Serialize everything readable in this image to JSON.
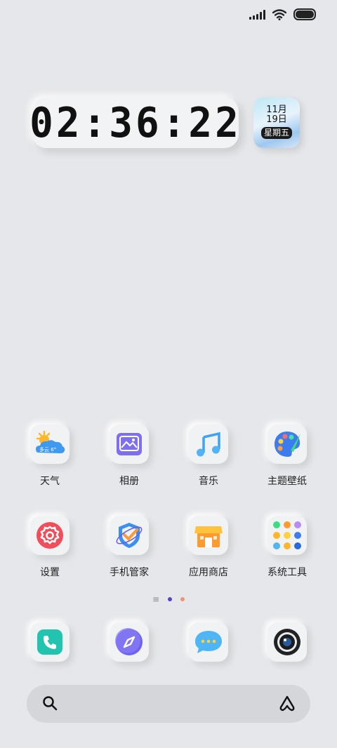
{
  "status_bar": {
    "icons": [
      "signal-icon",
      "wifi-icon",
      "battery-icon"
    ]
  },
  "clock_widget": {
    "time": "02:36:22"
  },
  "date_widget": {
    "month": "11月",
    "day": "19日",
    "weekday": "星期五"
  },
  "apps_row1": [
    {
      "label": "天气",
      "icon": "weather-icon",
      "temp_text": "多云 6°"
    },
    {
      "label": "相册",
      "icon": "gallery-icon"
    },
    {
      "label": "音乐",
      "icon": "music-icon"
    },
    {
      "label": "主题壁纸",
      "icon": "theme-icon"
    }
  ],
  "apps_row2": [
    {
      "label": "设置",
      "icon": "settings-icon"
    },
    {
      "label": "手机管家",
      "icon": "phone-manager-icon"
    },
    {
      "label": "应用商店",
      "icon": "app-store-icon"
    },
    {
      "label": "系统工具",
      "icon": "system-tools-icon"
    }
  ],
  "page_indicator": {
    "menu_glyph": "≡",
    "active_color": "#5b3fd1",
    "inactive_color": "#f0916f"
  },
  "dock": [
    {
      "icon": "phone-icon"
    },
    {
      "icon": "browser-icon"
    },
    {
      "icon": "messages-icon"
    },
    {
      "icon": "camera-icon"
    }
  ],
  "search_bar": {
    "search_icon": "search-icon",
    "assistant_icon": "assistant-icon"
  }
}
